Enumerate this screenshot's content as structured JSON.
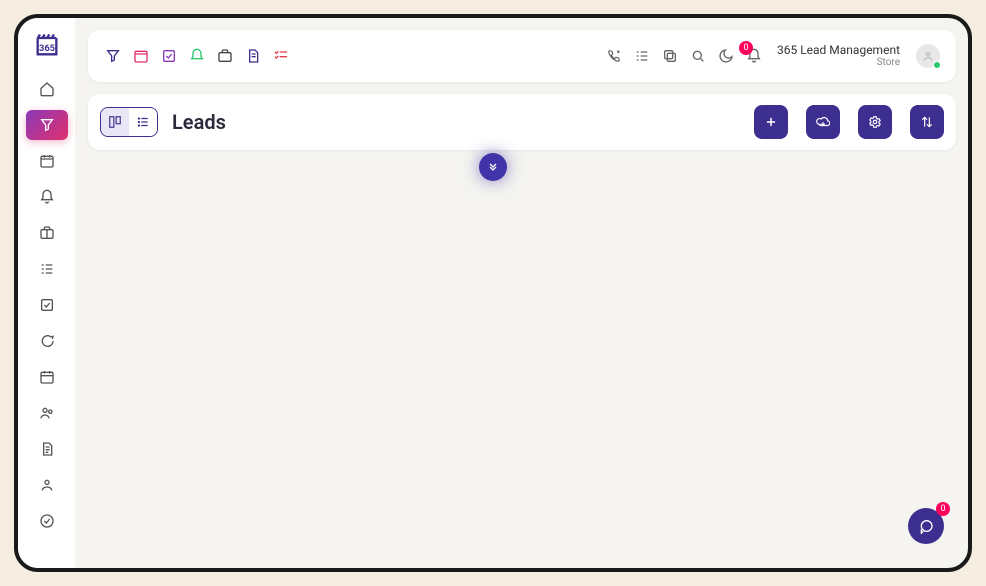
{
  "brand": "365",
  "topbar": {
    "notification_count": "0",
    "org_name": "365 Lead Management",
    "org_subtitle": "Store"
  },
  "page": {
    "title": "Leads"
  },
  "chat": {
    "count": "0"
  },
  "colors": {
    "primary": "#3d2f8f",
    "accent_gradient_start": "#8a3ab9",
    "accent_gradient_end": "#e1306c",
    "badge": "#ff005c"
  }
}
